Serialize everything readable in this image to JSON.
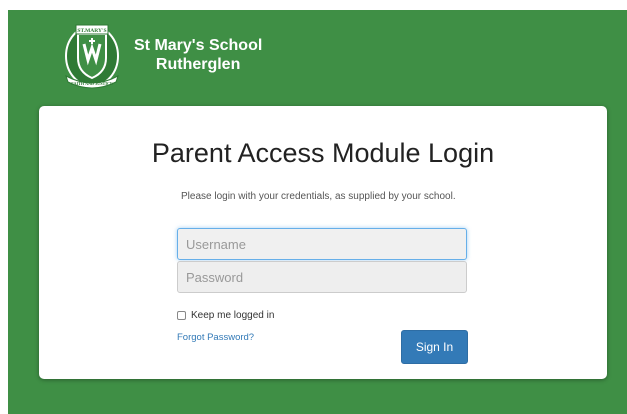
{
  "colors": {
    "background": "#3f8f45",
    "primary_button": "#337ab7",
    "link": "#337ab7",
    "focus_border": "#66afe9"
  },
  "header": {
    "crest_icon": "school-crest-icon",
    "crest_text_top": "ST.MARY'S",
    "crest_text_bottom": "FAITH AND JUSTICE",
    "school_name_line1": "St Mary's School",
    "school_name_line2": "Rutherglen"
  },
  "login": {
    "title": "Parent Access Module Login",
    "intro": "Please login with your credentials, as supplied by your school.",
    "username_placeholder": "Username",
    "username_value": "",
    "password_placeholder": "Password",
    "password_value": "",
    "remember_label": "Keep me logged in",
    "remember_checked": false,
    "forgot_link": "Forgot Password?",
    "sign_in_label": "Sign In"
  }
}
